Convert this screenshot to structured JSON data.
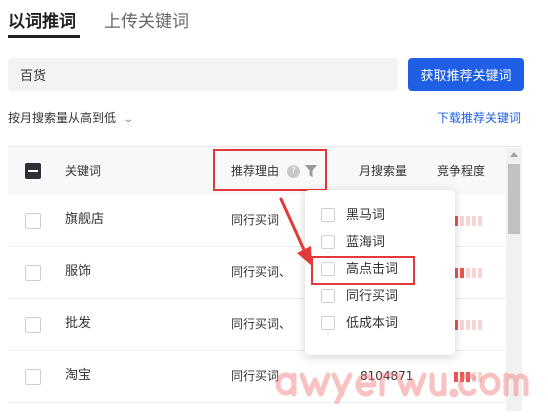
{
  "tabs": [
    {
      "label": "以词推词",
      "active": true
    },
    {
      "label": "上传关键词",
      "active": false
    }
  ],
  "search": {
    "value": "百货",
    "button_label": "获取推荐关键词"
  },
  "sort": {
    "label": "按月搜索量从高到低"
  },
  "download_link": "下载推荐关键词",
  "table": {
    "columns": [
      "关键词",
      "推荐理由",
      "月搜索量",
      "竞争程度"
    ],
    "help_icon_glyph": "?",
    "rows": [
      {
        "keyword": "旗舰店",
        "reason": "同行买词",
        "volume": "",
        "competition": 1
      },
      {
        "keyword": "服饰",
        "reason": "同行买词、",
        "volume": "",
        "competition": 2
      },
      {
        "keyword": "批发",
        "reason": "同行买词、",
        "volume": "",
        "competition": 1
      },
      {
        "keyword": "淘宝",
        "reason": "同行买词",
        "volume": "8104871",
        "competition": 3
      }
    ]
  },
  "filter_popup": {
    "options": [
      {
        "label": "黑马词",
        "checked": false
      },
      {
        "label": "蓝海词",
        "checked": false
      },
      {
        "label": "高点击词",
        "checked": false
      },
      {
        "label": "同行买词",
        "checked": false
      },
      {
        "label": "低成本词",
        "checked": false
      }
    ]
  },
  "watermark": "awyerwu.com",
  "colors": {
    "primary": "#1f5fe6",
    "highlight": "#e23a3a",
    "competition_on": "#e8534f",
    "competition_off": "#f8d4d2"
  }
}
